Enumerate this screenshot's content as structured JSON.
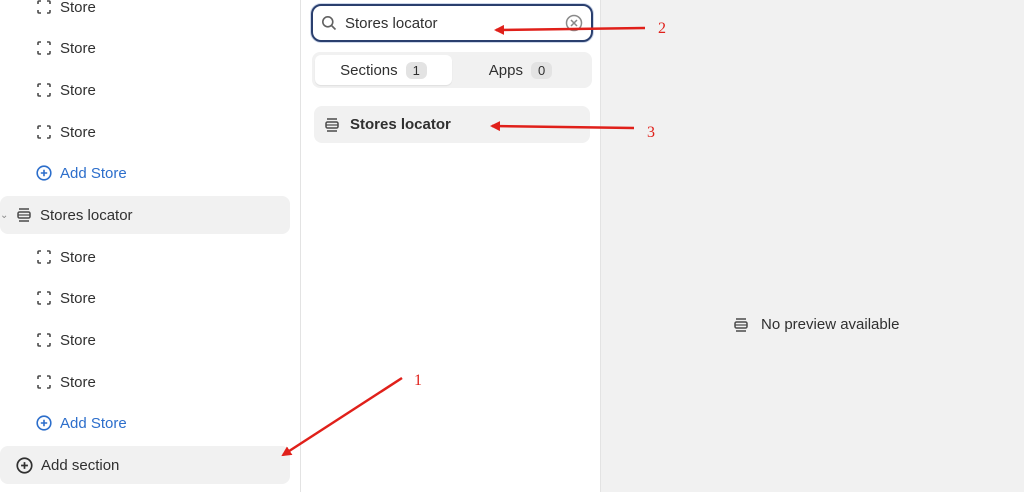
{
  "sidebar": {
    "items_top": [
      {
        "label": "Store"
      },
      {
        "label": "Store"
      },
      {
        "label": "Store"
      },
      {
        "label": "Store"
      }
    ],
    "add_store_1": "Add Store",
    "section_name": "Stores locator",
    "items_bottom": [
      {
        "label": "Store"
      },
      {
        "label": "Store"
      },
      {
        "label": "Store"
      },
      {
        "label": "Store"
      }
    ],
    "add_store_2": "Add Store",
    "add_section": "Add section"
  },
  "panel": {
    "search_value": "Stores locator",
    "tabs": [
      {
        "label": "Sections",
        "count": "1"
      },
      {
        "label": "Apps",
        "count": "0"
      }
    ],
    "result": "Stores locator"
  },
  "preview": {
    "message": "No preview available"
  },
  "annotations": {
    "n1": "1",
    "n2": "2",
    "n3": "3",
    "color": "#e0201a"
  }
}
